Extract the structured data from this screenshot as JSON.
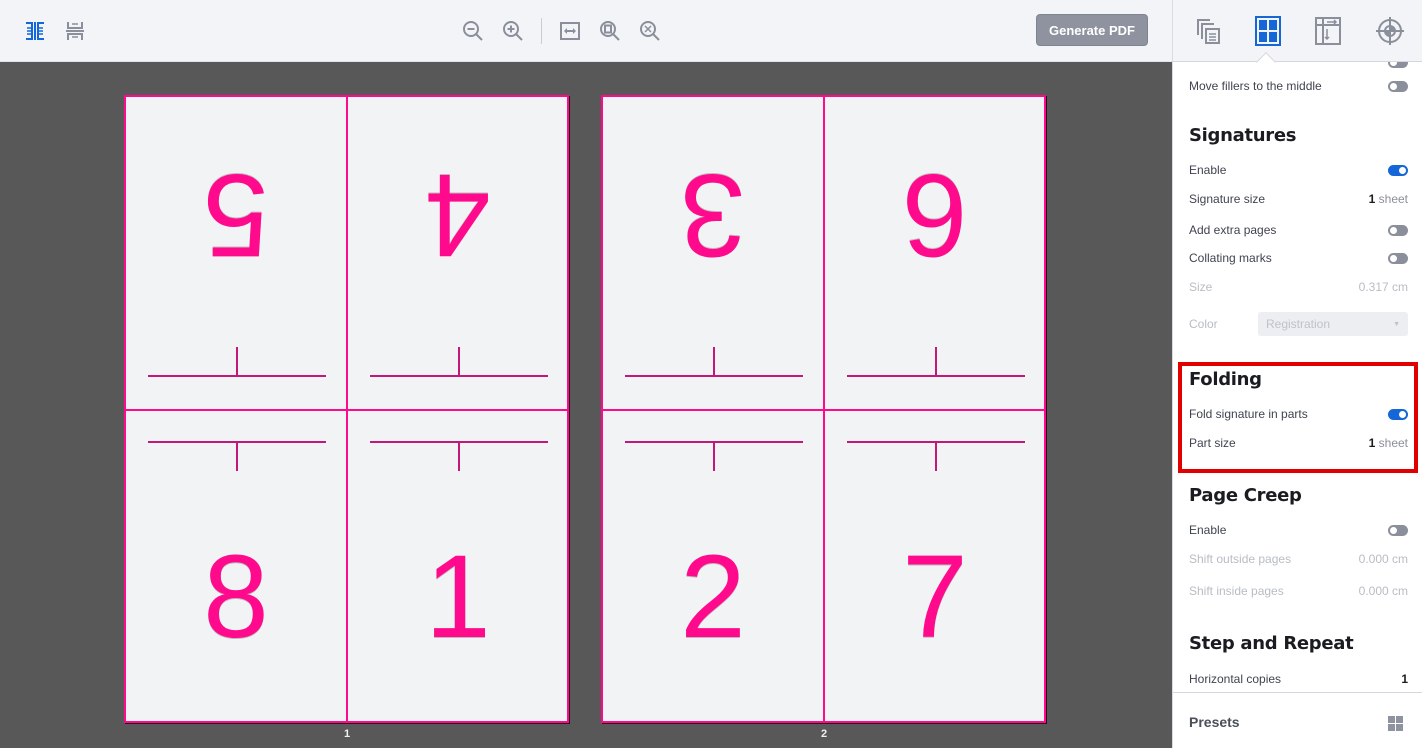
{
  "toolbar": {
    "left_icons": [
      "two-page-spread-icon",
      "single-page-icon"
    ],
    "zoom_icons": [
      "zoom-out-icon",
      "zoom-in-icon",
      "fit-width-icon",
      "fit-page-icon",
      "zoom-fit-all-icon"
    ],
    "generate_pdf_label": "Generate PDF"
  },
  "canvas": {
    "sheets": [
      {
        "label": "1",
        "pages": {
          "top_left": "5",
          "top_right": "4",
          "bottom_left": "8",
          "bottom_right": "1"
        }
      },
      {
        "label": "2",
        "pages": {
          "top_left": "3",
          "top_right": "6",
          "bottom_left": "2",
          "bottom_right": "7"
        }
      }
    ],
    "guide_color": "#ff0a8c"
  },
  "sidebar": {
    "tabs": [
      "pages-icon",
      "layout-grid-icon",
      "margins-icon",
      "marks-target-icon"
    ],
    "active_tab": "layout-grid-icon",
    "top_rows": {
      "move_fillers_label": "Move fillers to the middle",
      "move_fillers_on": false
    },
    "signatures": {
      "title": "Signatures",
      "enable_label": "Enable",
      "enable_on": true,
      "size_label": "Signature size",
      "size_value": "1",
      "size_unit": "sheet",
      "extra_pages_label": "Add extra pages",
      "extra_pages_on": false,
      "collating_label": "Collating marks",
      "collating_on": false,
      "mark_size_label": "Size",
      "mark_size_value": "0.317 cm",
      "color_label": "Color",
      "color_value": "Registration"
    },
    "folding": {
      "title": "Folding",
      "fold_label": "Fold signature in parts",
      "fold_on": true,
      "part_size_label": "Part size",
      "part_size_value": "1",
      "part_size_unit": "sheet"
    },
    "page_creep": {
      "title": "Page Creep",
      "enable_label": "Enable",
      "enable_on": false,
      "outside_label": "Shift outside pages",
      "outside_value": "0.000 cm",
      "inside_label": "Shift inside pages",
      "inside_value": "0.000 cm"
    },
    "step_repeat": {
      "title": "Step and Repeat",
      "horizontal_label": "Horizontal copies",
      "horizontal_value": "1"
    },
    "footer": {
      "presets_label": "Presets"
    },
    "highlight_color": "#e00000",
    "accent_color": "#1566d6"
  }
}
